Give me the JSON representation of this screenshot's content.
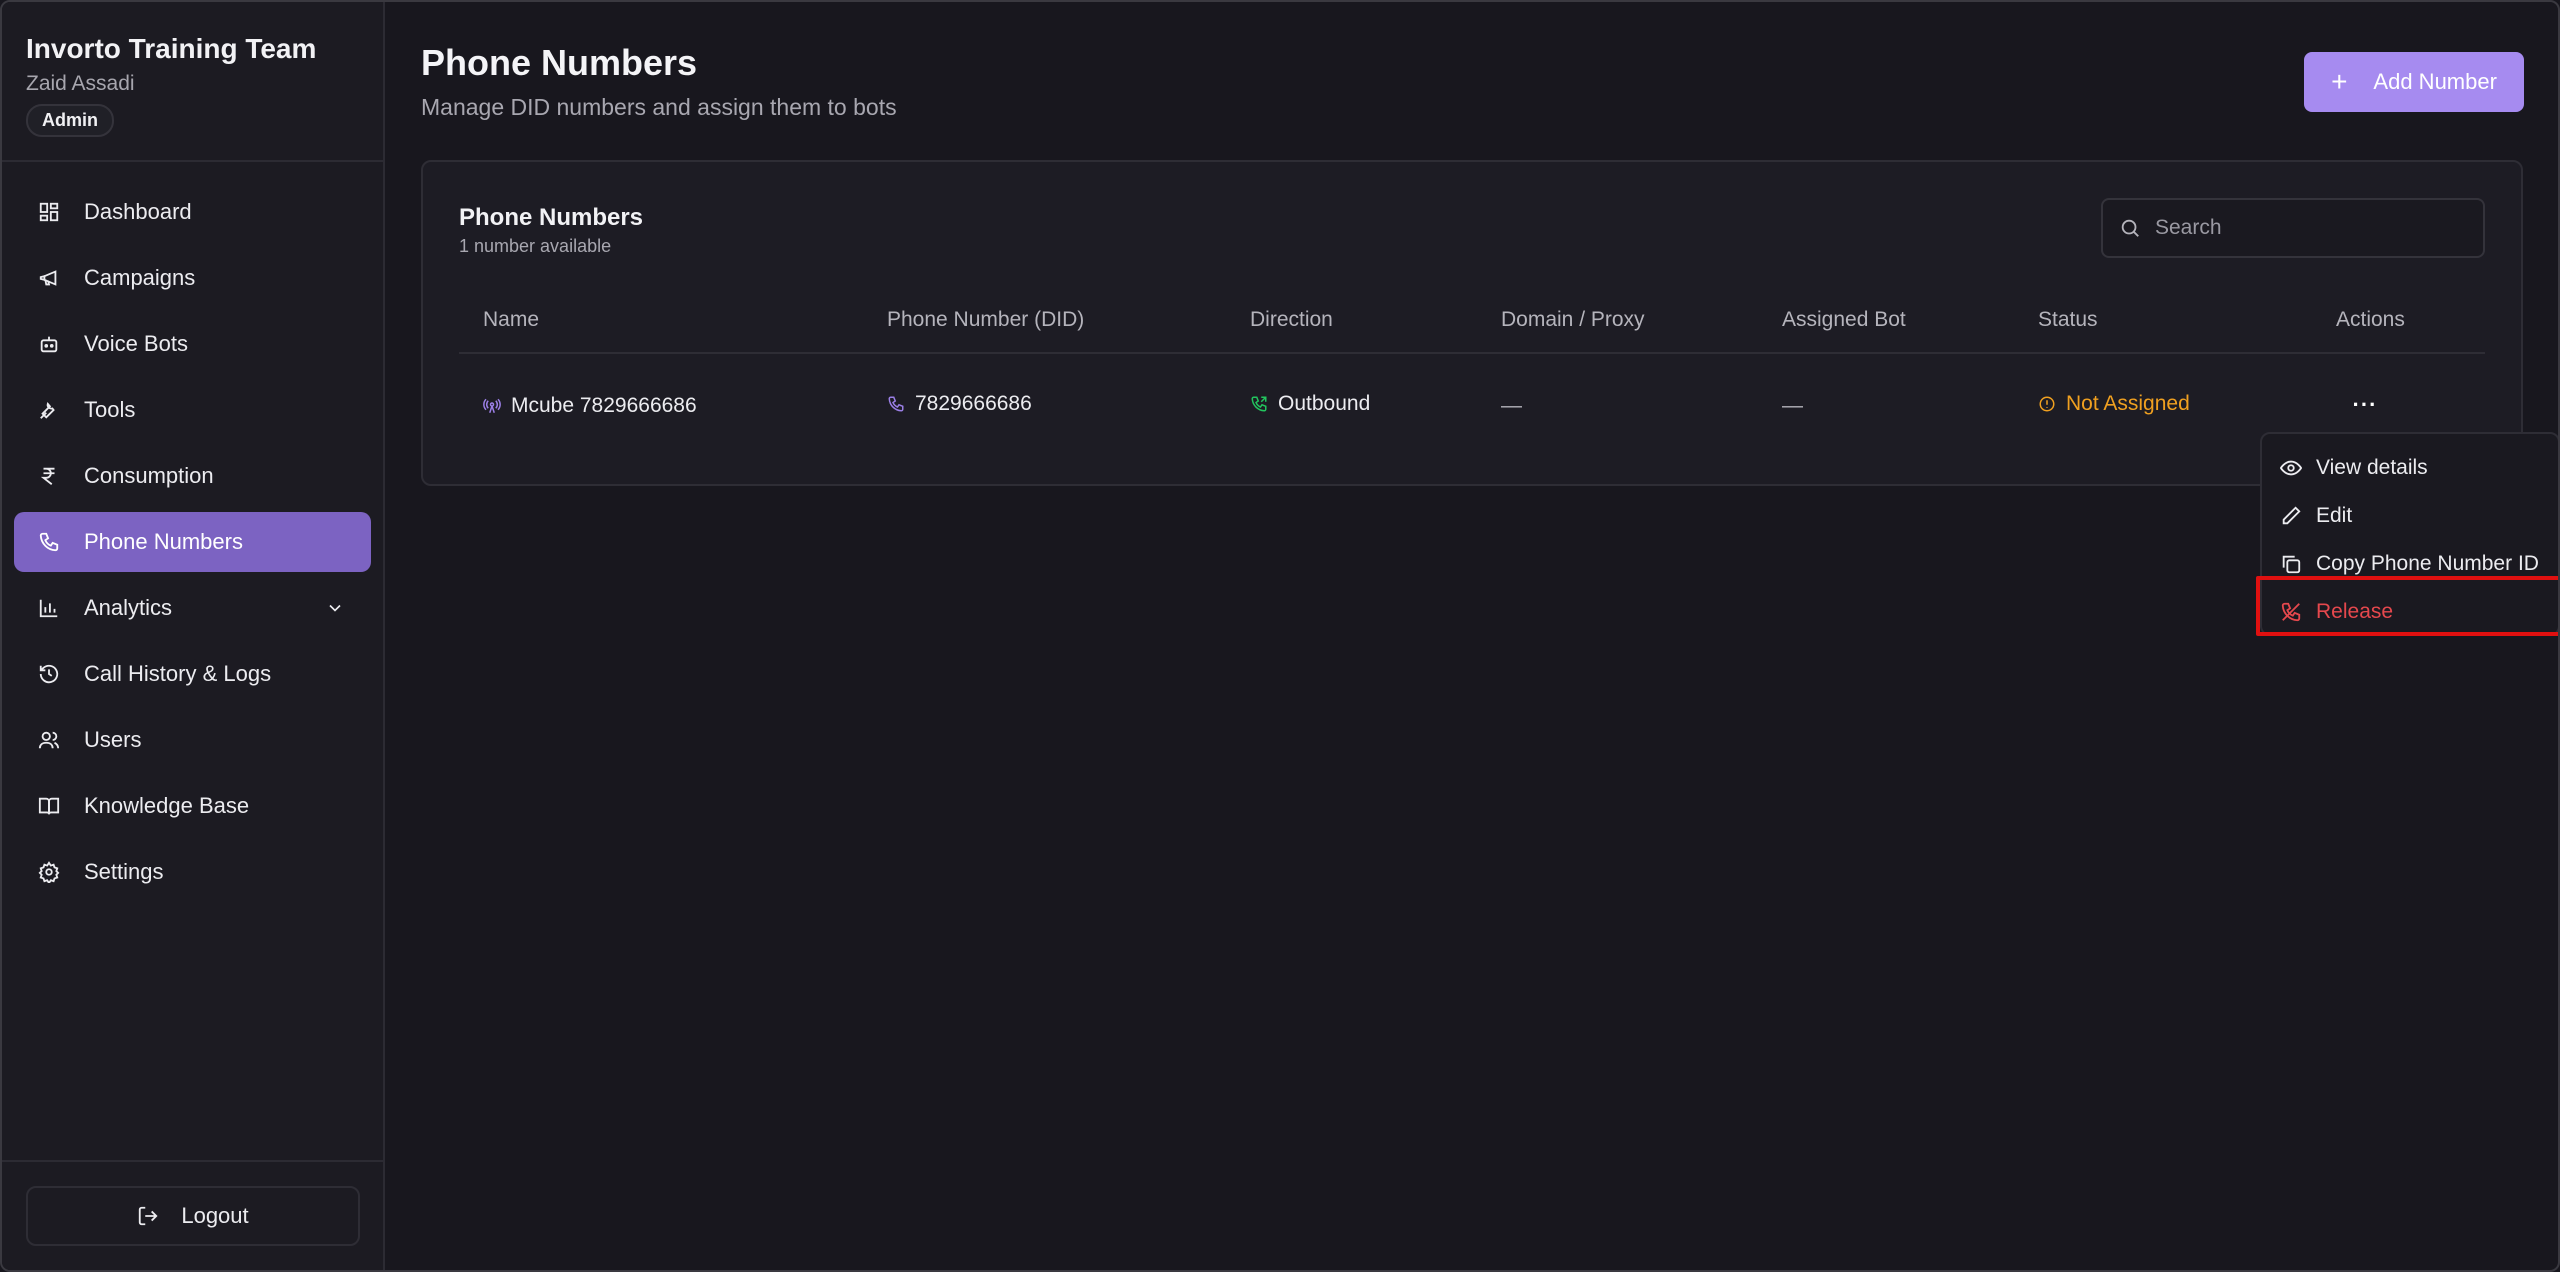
{
  "org": {
    "name": "Invorto Training Team",
    "user": "Zaid Assadi",
    "role": "Admin"
  },
  "nav": [
    {
      "label": "Dashboard",
      "icon": "dashboard-icon"
    },
    {
      "label": "Campaigns",
      "icon": "megaphone-icon"
    },
    {
      "label": "Voice Bots",
      "icon": "bot-icon"
    },
    {
      "label": "Tools",
      "icon": "wrench-icon"
    },
    {
      "label": "Consumption",
      "icon": "rupee-icon"
    },
    {
      "label": "Phone Numbers",
      "icon": "phone-icon",
      "active": true
    },
    {
      "label": "Analytics",
      "icon": "bar-chart-icon"
    },
    {
      "label": "Call History & Logs",
      "icon": "history-icon"
    },
    {
      "label": "Users",
      "icon": "users-icon"
    },
    {
      "label": "Knowledge Base",
      "icon": "book-icon"
    },
    {
      "label": "Settings",
      "icon": "gear-icon"
    }
  ],
  "logout_label": "Logout",
  "page": {
    "title": "Phone Numbers",
    "subtitle": "Manage DID numbers and assign them to bots",
    "add_button": "Add Number"
  },
  "card": {
    "title": "Phone Numbers",
    "count_text": "1 number available",
    "search_placeholder": "Search"
  },
  "table": {
    "headers": [
      "Name",
      "Phone Number (DID)",
      "Direction",
      "Domain / Proxy",
      "Assigned Bot",
      "Status",
      "Actions"
    ],
    "rows": [
      {
        "name": "Mcube 7829666686",
        "did": "7829666686",
        "direction": "Outbound",
        "domain": "—",
        "bot": "—",
        "status": "Not Assigned",
        "actions": "···"
      }
    ]
  },
  "menu": {
    "items": [
      {
        "label": "View details",
        "icon": "eye-icon"
      },
      {
        "label": "Edit",
        "icon": "pencil-icon"
      },
      {
        "label": "Copy Phone Number ID",
        "icon": "copy-icon"
      },
      {
        "label": "Release",
        "icon": "phone-off-icon",
        "danger": true
      }
    ]
  },
  "colors": {
    "accent": "#7c63c2",
    "button": "#a68bf0",
    "warning": "#f0a020",
    "danger": "#e5484d",
    "success": "#22c55e"
  }
}
